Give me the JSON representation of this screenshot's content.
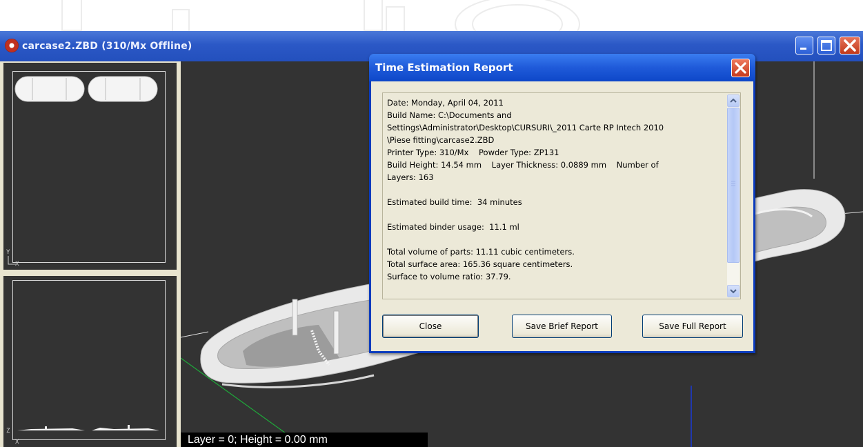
{
  "window": {
    "title": "carcase2.ZBD (310/Mx Offline)"
  },
  "views": {
    "top_axes": {
      "y": "Y",
      "x": "X"
    },
    "front_axes": {
      "z": "Z",
      "x": "X"
    }
  },
  "status_bar": {
    "text": "Layer = 0; Height = 0.00 mm"
  },
  "dialog": {
    "title": "Time Estimation Report",
    "report_lines": [
      "Date: Monday, April 04, 2011",
      "Build Name: C:\\Documents and",
      "Settings\\Administrator\\Desktop\\CURSURI\\_2011 Carte RP Intech 2010",
      "\\Piese fitting\\carcase2.ZBD",
      "Printer Type: 310/Mx    Powder Type: ZP131",
      "Build Height: 14.54 mm    Layer Thickness: 0.0889 mm    Number of",
      "Layers: 163",
      "",
      "Estimated build time:  34 minutes",
      "",
      "Estimated binder usage:  11.1 ml",
      "",
      "Total volume of parts: 11.11 cubic centimeters.",
      "Total surface area: 165.36 square centimeters.",
      "Surface to volume ratio: 37.79."
    ],
    "buttons": {
      "close": "Close",
      "save_brief": "Save Brief Report",
      "save_full": "Save Full Report"
    }
  },
  "colors": {
    "titlebar": "#2b58c6",
    "dialog_body": "#ece9d8",
    "viewport_bg": "#333333",
    "close_red": "#c53a1d"
  }
}
